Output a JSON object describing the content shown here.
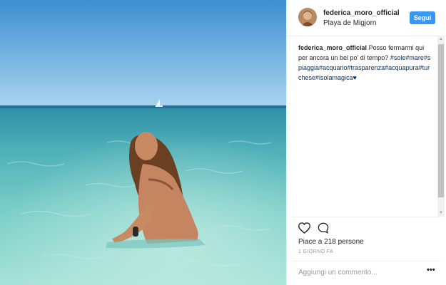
{
  "post": {
    "photo_alt": "Woman in clear turquoise sea",
    "author": {
      "username": "federica_moro_official",
      "location": "Playa de Migjorn"
    },
    "follow_label": "Segui",
    "caption": {
      "username": "federica_moro_official",
      "text": "Posso fermarmi qui per ancora un bel po' di tempo?",
      "hashtags": "#sole#mare#spiaggia#acquario#trasparenza#acquapura#turchese#isolamagica",
      "emoji": "♥"
    },
    "likes_text": "Piace a 218 persone",
    "time_ago": "1 GIORNO FA",
    "comment_placeholder": "Aggiungi un commento...",
    "more_label": "•••",
    "icons": [
      "heart-icon",
      "comment-icon",
      "more-options-icon"
    ]
  },
  "colors": {
    "follow_button": "#3897f0",
    "hashtag": "#003569",
    "text": "#262626",
    "muted": "#999999"
  }
}
